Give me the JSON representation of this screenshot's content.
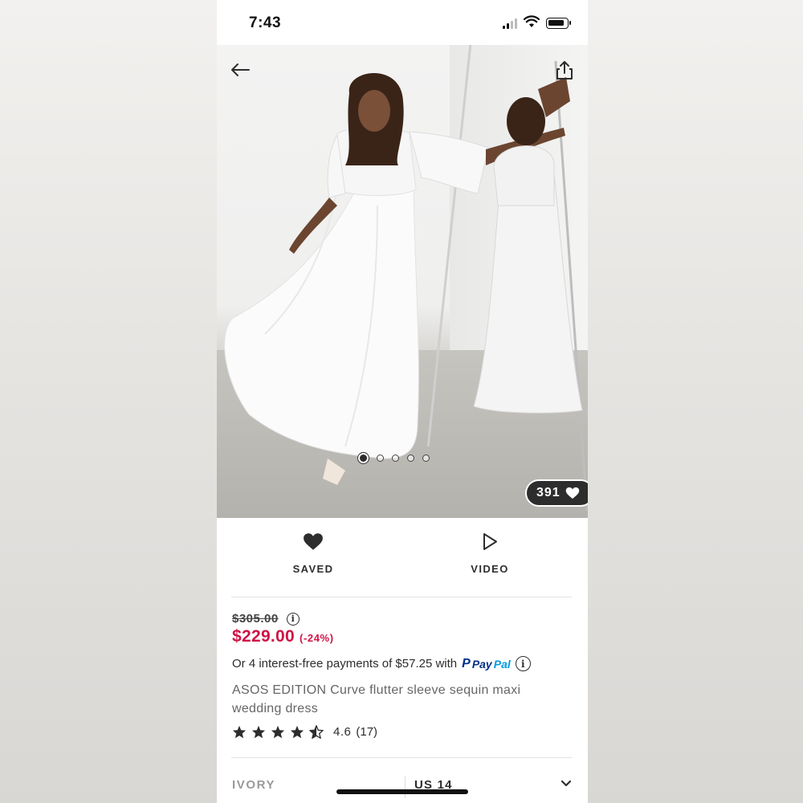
{
  "status_bar": {
    "time": "7:43"
  },
  "hero": {
    "image_alt": "Model wearing white sequin maxi wedding dress",
    "slide_count": 5,
    "active_slide": 1,
    "likes": "391"
  },
  "actions": {
    "saved_label": "SAVED",
    "video_label": "VIDEO"
  },
  "product": {
    "old_price": "$305.00",
    "price": "$229.00",
    "discount": "(-24%)",
    "installments_text": "Or 4 interest-free payments of $57.25 with",
    "paypal_a": "Pay",
    "paypal_b": "Pal",
    "title": "ASOS EDITION Curve flutter sleeve sequin maxi wedding dress",
    "rating_value": "4.6",
    "rating_count": "(17)",
    "rating": 4.5,
    "colour": "IVORY",
    "size": "US 14"
  },
  "colors": {
    "accent_price": "#d01345",
    "text_dark": "#2d2d2d",
    "paypal_dark": "#003087",
    "paypal_light": "#009cde"
  },
  "icons": [
    "back-arrow-icon",
    "share-icon",
    "heart-icon",
    "play-icon",
    "info-icon",
    "star-icon",
    "chevron-down-icon"
  ]
}
